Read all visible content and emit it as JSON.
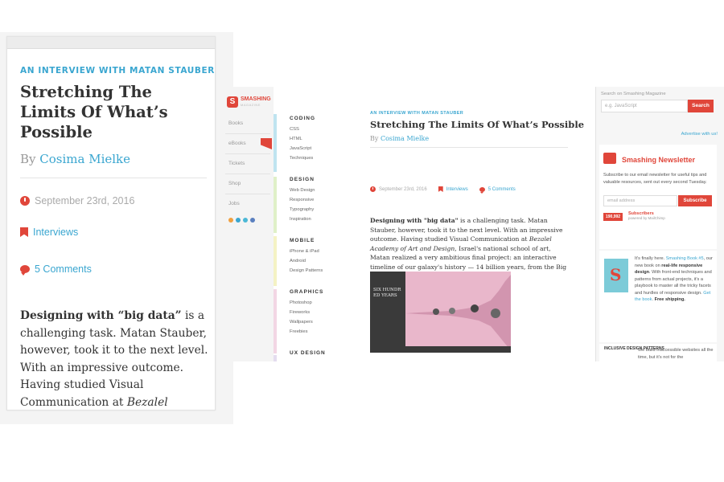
{
  "mobile": {
    "kicker": "AN INTERVIEW WITH MATAN STAUBER",
    "title": "Stretching The Limits Of What’s Possible",
    "by": "By",
    "author": "Cosima Mielke",
    "date": "September 23rd, 2016",
    "category": "Interviews",
    "comments": "5 Comments",
    "body_bold": "Designing with “big data”",
    "body_1": " is a challenging task. Matan Stauber, however, took it to the next level. With an impressive outcome. Having studied Visual Communication at ",
    "body_italic": "Bezalel"
  },
  "desktop": {
    "logo_name": "SMASHING",
    "logo_sub": "MAGAZINE",
    "nav": [
      "Books",
      "eBooks",
      "Tickets",
      "Shop",
      "Jobs"
    ],
    "categories": [
      {
        "title": "CODING",
        "items": [
          "CSS",
          "HTML",
          "JavaScript",
          "Techniques"
        ]
      },
      {
        "title": "DESIGN",
        "items": [
          "Web Design",
          "Responsive",
          "Typography",
          "Inspiration"
        ]
      },
      {
        "title": "MOBILE",
        "items": [
          "iPhone & iPad",
          "Android",
          "Design Patterns"
        ]
      },
      {
        "title": "GRAPHICS",
        "items": [
          "Photoshop",
          "Fireworks",
          "Wallpapers",
          "Freebies"
        ]
      },
      {
        "title": "UX DESIGN",
        "items": []
      }
    ],
    "article": {
      "kicker": "AN INTERVIEW WITH MATAN STAUBER",
      "title": "Stretching The Limits Of What’s Possible",
      "by": "By",
      "author": "Cosima Mielke",
      "date": "September 23rd, 2016",
      "category": "Interviews",
      "comments": "5 Comments",
      "body_bold": "Designing with \"big data\"",
      "body_1": " is a challenging task. Matan Stauber, however, took it to the next level. With an impressive outcome. Having studied Visual Communication at ",
      "body_italic": "Bezalel Academy of Art and Design",
      "body_2": ", Israel's national school of art, Matan realized a very ambitious final project: an interactive timeline of our galaxy's history — 14 billion years, from the Big Bang to today.",
      "figure_text": "SIX HUNDR ED YEARS"
    },
    "sidebar": {
      "search_label": "Search on Smashing Magazine",
      "search_placeholder": "e.g. JavaScript",
      "search_button": "Search",
      "advertise": "Advertise with us!",
      "newsletter_title": "Smashing Newsletter",
      "newsletter_text": "Subscribe to our email newsletter for useful tips and valuable resources, sent out every second Tuesday.",
      "email_placeholder": "email address",
      "subscribe_button": "Subscribe",
      "subscriber_count": "190,992",
      "subscribers_label": "Subscribers",
      "powered_by": "powered by MailChimp",
      "book_1": "It's finally here. ",
      "book_link_1": "Smashing Book #5",
      "book_2": ", our new book on ",
      "book_bold_1": "real-life responsive design",
      "book_3": ". With front-end techniques and patterns from actual projects, it's a playbook to master all the tricky facets and hurdles of responsive design. ",
      "book_link_2": "Get the book",
      "book_4": ". ",
      "book_bold_2": "Free shipping.",
      "inclusive_cover": "INCLUSIVE DESIGN PATTERNS",
      "inclusive_text": "We build inaccessible websites all the time, but it's not for the"
    }
  },
  "colors": {
    "accent_blue": "#3aa6d0",
    "accent_red": "#e0463a",
    "text_dark": "#333333",
    "figure_pink": "#e9b7cb"
  }
}
